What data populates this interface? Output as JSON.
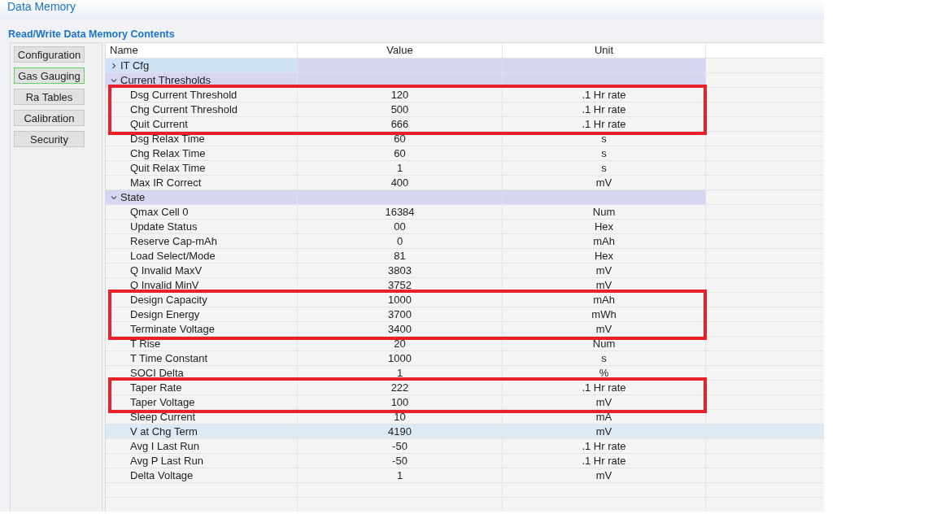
{
  "window": {
    "title": "Data Memory"
  },
  "section_title": "Read/Write Data Memory Contents",
  "categories": [
    {
      "label": "Configuration",
      "selected": false
    },
    {
      "label": "Gas Gauging",
      "selected": true
    },
    {
      "label": "Ra Tables",
      "selected": false
    },
    {
      "label": "Calibration",
      "selected": false
    },
    {
      "label": "Security",
      "selected": false
    }
  ],
  "table": {
    "columns": [
      "Name",
      "Value",
      "Unit"
    ],
    "groups": [
      {
        "name": "IT Cfg",
        "expanded": false,
        "selected": true
      },
      {
        "name": "Current Thresholds",
        "expanded": true,
        "selected": false,
        "rows": [
          {
            "name": "Dsg Current Threshold",
            "value": "120",
            "unit": ".1 Hr rate",
            "selected": false,
            "outlined": true
          },
          {
            "name": "Chg Current Threshold",
            "value": "500",
            "unit": ".1 Hr rate",
            "selected": false,
            "outlined": true
          },
          {
            "name": "Quit Current",
            "value": "666",
            "unit": ".1 Hr rate",
            "selected": false,
            "outlined": true
          },
          {
            "name": "Dsg Relax Time",
            "value": "60",
            "unit": "s",
            "selected": false,
            "outlined": false
          },
          {
            "name": "Chg Relax Time",
            "value": "60",
            "unit": "s",
            "selected": false,
            "outlined": false
          },
          {
            "name": "Quit Relax Time",
            "value": "1",
            "unit": "s",
            "selected": false,
            "outlined": false
          },
          {
            "name": "Max IR Correct",
            "value": "400",
            "unit": "mV",
            "selected": false,
            "outlined": false
          }
        ]
      },
      {
        "name": "State",
        "expanded": true,
        "selected": false,
        "rows": [
          {
            "name": "Qmax Cell 0",
            "value": "16384",
            "unit": "Num",
            "selected": false,
            "outlined": false
          },
          {
            "name": "Update Status",
            "value": "00",
            "unit": "Hex",
            "selected": false,
            "outlined": false
          },
          {
            "name": "Reserve Cap-mAh",
            "value": "0",
            "unit": "mAh",
            "selected": false,
            "outlined": false
          },
          {
            "name": "Load Select/Mode",
            "value": "81",
            "unit": "Hex",
            "selected": false,
            "outlined": false
          },
          {
            "name": "Q Invalid MaxV",
            "value": "3803",
            "unit": "mV",
            "selected": false,
            "outlined": false
          },
          {
            "name": "Q Invalid MinV",
            "value": "3752",
            "unit": "mV",
            "selected": false,
            "outlined": false
          },
          {
            "name": "Design Capacity",
            "value": "1000",
            "unit": "mAh",
            "selected": false,
            "outlined": true
          },
          {
            "name": "Design Energy",
            "value": "3700",
            "unit": "mWh",
            "selected": false,
            "outlined": true
          },
          {
            "name": "Terminate Voltage",
            "value": "3400",
            "unit": "mV",
            "selected": false,
            "outlined": true
          },
          {
            "name": "T Rise",
            "value": "20",
            "unit": "Num",
            "selected": false,
            "outlined": false
          },
          {
            "name": "T Time Constant",
            "value": "1000",
            "unit": "s",
            "selected": false,
            "outlined": false
          },
          {
            "name": "SOCI Delta",
            "value": "1",
            "unit": "%",
            "selected": false,
            "outlined": false
          },
          {
            "name": "Taper Rate",
            "value": "222",
            "unit": ".1 Hr rate",
            "selected": false,
            "outlined": true
          },
          {
            "name": "Taper Voltage",
            "value": "100",
            "unit": "mV",
            "selected": false,
            "outlined": true
          },
          {
            "name": "Sleep Current",
            "value": "10",
            "unit": "mA",
            "selected": false,
            "outlined": false
          },
          {
            "name": "V at Chg Term",
            "value": "4190",
            "unit": "mV",
            "selected": true,
            "outlined": false
          },
          {
            "name": "Avg I Last Run",
            "value": "-50",
            "unit": ".1 Hr rate",
            "selected": false,
            "outlined": false
          },
          {
            "name": "Avg P Last Run",
            "value": "-50",
            "unit": ".1 Hr rate",
            "selected": false,
            "outlined": false
          },
          {
            "name": "Delta Voltage",
            "value": "1",
            "unit": "mV",
            "selected": false,
            "outlined": false
          }
        ]
      }
    ]
  }
}
